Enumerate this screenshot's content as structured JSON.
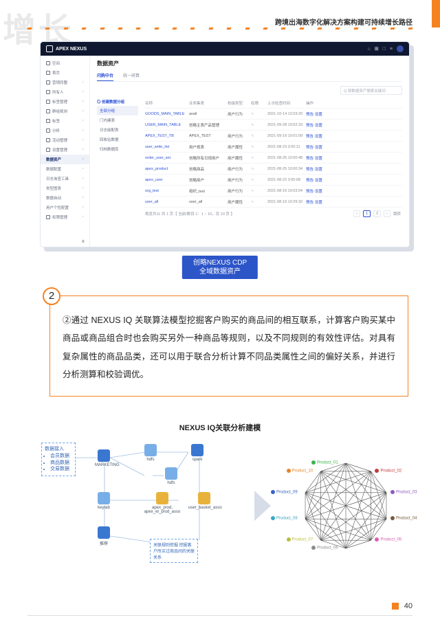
{
  "watermark": "增长",
  "header_title": "跨境出海数字化解决方案构建可持续增长路径",
  "page_number": "40",
  "app": {
    "brand": "APEX NEXUS",
    "header_icons": [
      "⌂",
      "⊞",
      "□",
      "≡"
    ],
    "sidebar": [
      {
        "icon": true,
        "label": "空间",
        "caret": false
      },
      {
        "icon": true,
        "label": "首页",
        "caret": false
      },
      {
        "icon": true,
        "label": "营销同盟",
        "caret": true
      },
      {
        "icon": true,
        "label": "所有人",
        "caret": true
      },
      {
        "icon": true,
        "label": "标签管理",
        "caret": true
      },
      {
        "icon": true,
        "label": "群组规则",
        "caret": true
      },
      {
        "icon": true,
        "label": "标签",
        "caret": true
      },
      {
        "icon": true,
        "label": "分析",
        "caret": true
      },
      {
        "icon": true,
        "label": "活动管理",
        "caret": true
      },
      {
        "icon": true,
        "label": "设置管理",
        "caret": true
      },
      {
        "icon": false,
        "label": "数据资产",
        "caret": true,
        "active": true
      },
      {
        "icon": false,
        "label": "数据配置",
        "caret": true
      },
      {
        "icon": false,
        "label": "日志询查工具",
        "caret": true
      },
      {
        "icon": false,
        "label": "类型图表",
        "caret": true
      },
      {
        "icon": false,
        "label": "数据自动",
        "caret": true
      },
      {
        "icon": false,
        "label": "用户个性配置",
        "caret": true
      },
      {
        "icon": true,
        "label": "权限管理",
        "caret": true
      }
    ],
    "page_title": "数据资产",
    "tabs": [
      {
        "label": "闪购中台",
        "active": true
      },
      {
        "label": "统一研算",
        "active": false
      }
    ],
    "search_placeholder": "Q 按数据资产搜索关键词",
    "filter": {
      "head": "◎ 创建数据分组",
      "items": [
        {
          "label": "全部分组",
          "sel": true
        },
        {
          "label": "门内建表",
          "sel": false
        },
        {
          "label": "日志级配表",
          "sel": false
        },
        {
          "label": "回收站数据",
          "sel": false
        },
        {
          "label": "归档数据库",
          "sel": false
        }
      ]
    },
    "columns": [
      "名称",
      "业务集表",
      "校级类型",
      "权限",
      "上次检查时间",
      "操作"
    ],
    "rows": [
      {
        "name": "GOODS_MAIN_TABLE",
        "src": "avail",
        "type": "用户行为",
        "ext": "∿",
        "time": "2021-10-14 12:03:20",
        "ops": "预告·设置"
      },
      {
        "name": "USER_MAIN_TABLE",
        "src": "创略主表产品管理",
        "type": "",
        "ext": "∿",
        "time": "2021-09-28 10:02:33",
        "ops": "预告·设置"
      },
      {
        "name": "APEX_TEST_TB",
        "src": "APEX_TEST",
        "type": "用户行为",
        "ext": "∿",
        "time": "2021-09-19 10:01:09",
        "ops": "预告·设置"
      },
      {
        "name": "user_write_list",
        "src": "用户规表",
        "type": "用户属性",
        "ext": "∿",
        "time": "2021-08-23 3:00:11",
        "ops": "预告·设置"
      },
      {
        "name": "order_user_set",
        "src": "创略所有日规用户",
        "type": "用户属性",
        "ext": "∿",
        "time": "2021-08-25 10:00:48",
        "ops": "预告·设置"
      },
      {
        "name": "apex_product",
        "src": "创略商品",
        "type": "用户行为",
        "ext": "∿",
        "time": "2021-08-25 10:00:34",
        "ops": "预告·设置"
      },
      {
        "name": "apex_user",
        "src": "创略用户",
        "type": "用户行为",
        "ext": "∿",
        "time": "2021-08-22 3:00:08",
        "ops": "预告·设置"
      },
      {
        "name": "org_test",
        "src": "组织_test",
        "type": "用户行为",
        "ext": "∿",
        "time": "2021-08-19 10:03:04",
        "ops": "预告·设置"
      },
      {
        "name": "user_all",
        "src": "user_all",
        "type": "用户属性",
        "ext": "∿",
        "time": "2021-08-19 10:29:32",
        "ops": "预告·设置"
      }
    ],
    "pager": {
      "counts": "规览共11·共 1 页【 当前/数目 1：1 ~ 10，仅 10 页 】",
      "prev": "‹",
      "cur": "1",
      "next": "2",
      "nxt2": "›",
      "jump": "跳转"
    }
  },
  "app_label_line1": "创略NEXUS CDP",
  "app_label_line2": "全域数据资产",
  "step_number": "2",
  "step_text": "②通过 NEXUS IQ 关联算法模型挖掘客户购买的商品间的相互联系，计算客户购买某中商品或商品组合时也会购买另外一种商品等规则，以及不同规则的有效性评估。对具有复杂属性的商品品类，还可以用于联合分析计算不同品类属性之间的偏好关系，并进行分析测算和校验调优。",
  "diagram_title": "NEXUS IQ关联分析建模",
  "flow": {
    "input_title": "数据接入",
    "input_items": [
      "会员数据",
      "商品数据",
      "交易数据"
    ],
    "nodes": {
      "n_market": "MARKETING",
      "n_hdfs1": "hdfs",
      "n_hdfs2": "hdfs",
      "n_spark": "spark",
      "n_keytab": "keytab",
      "n_dp1": "apex_prod, apex_et_prod_asso",
      "n_dp2": "user_basket_asso",
      "n_rec": "推荐",
      "cluster": "关联规则挖掘  挖掘客户所买过商品间的关联关系"
    }
  },
  "graph": {
    "n": 10,
    "labels": [
      "Product_01",
      "Product_02",
      "Product_03",
      "Product_04",
      "Product_05",
      "Product_06",
      "Product_07",
      "Product_08",
      "Product_09",
      "Product_10"
    ],
    "colors": [
      "#3bb34a",
      "#c43a3a",
      "#8f58c7",
      "#7a5a3c",
      "#d95fb0",
      "#8b8b8b",
      "#b8bf3f",
      "#3aa7c2",
      "#3a62c2",
      "#e4852b"
    ]
  }
}
